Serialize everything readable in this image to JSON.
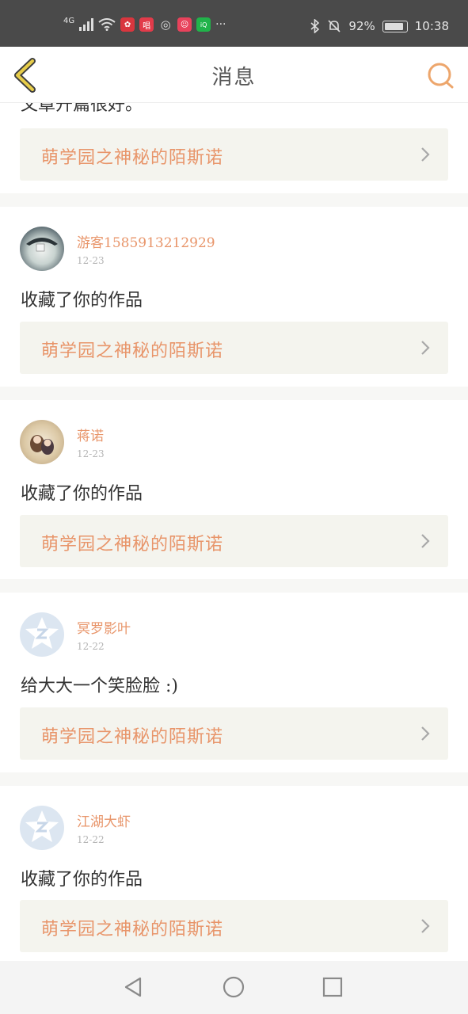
{
  "status_bar": {
    "network": "4G",
    "battery_percent": "92%",
    "battery_level": 0.92,
    "time": "10:38",
    "more": "···",
    "app_icons": [
      "huawei-icon",
      "changba-icon",
      "wechat-icon",
      "pinduoduo-icon",
      "iqiyi-icon"
    ]
  },
  "header": {
    "title": "消息"
  },
  "feed": {
    "partial_top_text": "文章开篇很好。",
    "first_work_title": "萌学园之神秘的陌斯诺",
    "items": [
      {
        "username": "游客1585913212929",
        "date": "12-23",
        "message": "收藏了你的作品",
        "work_title": "萌学园之神秘的陌斯诺",
        "avatar": "photo-avatar"
      },
      {
        "username": "蒋诺",
        "date": "12-23",
        "message": "收藏了你的作品",
        "work_title": "萌学园之神秘的陌斯诺",
        "avatar": "anime-avatar"
      },
      {
        "username": "冥罗影叶",
        "date": "12-22",
        "message": "给大大一个笑脸脸 :)",
        "work_title": "萌学园之神秘的陌斯诺",
        "avatar": "qq-default-avatar"
      },
      {
        "username": "江湖大虾",
        "date": "12-22",
        "message": "收藏了你的作品",
        "work_title": "萌学园之神秘的陌斯诺",
        "avatar": "qq-default-avatar"
      }
    ]
  },
  "colors": {
    "accent": "#e8956a",
    "status_bar": "#4a4a4a",
    "link_bg": "#f4f4ee"
  }
}
